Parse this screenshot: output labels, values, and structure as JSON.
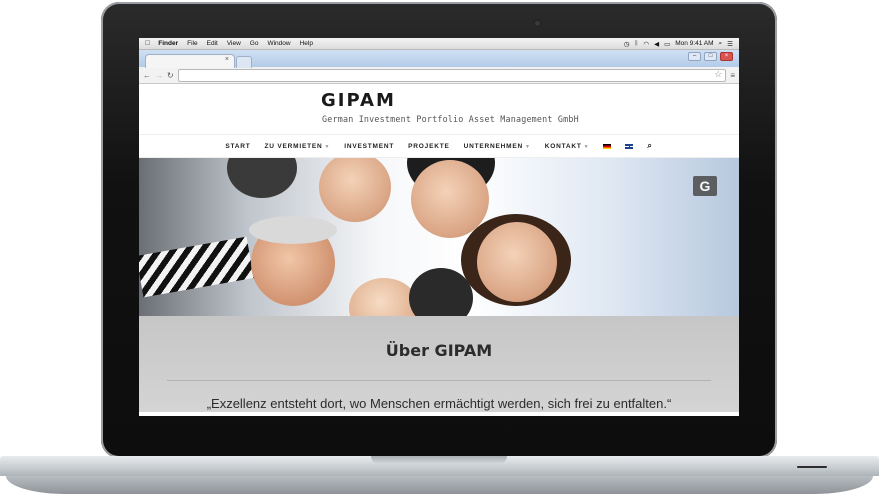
{
  "menubar": {
    "apple": "",
    "items": [
      "Finder",
      "File",
      "Edit",
      "View",
      "Go",
      "Window",
      "Help"
    ],
    "clock": "Mon 9:41 AM"
  },
  "browser": {
    "tab_close": "×",
    "address": "",
    "window_controls": [
      "–",
      "□",
      "×"
    ]
  },
  "site": {
    "logo": "GIPAM",
    "tagline": "German Investment Portfolio Asset Management GmbH",
    "nav": [
      {
        "label": "START"
      },
      {
        "label": "ZU VERMIETEN",
        "dropdown": true
      },
      {
        "label": "INVESTMENT"
      },
      {
        "label": "PROJEKTE"
      },
      {
        "label": "UNTERNEHMEN",
        "dropdown": true
      },
      {
        "label": "KONTAKT",
        "dropdown": true
      }
    ],
    "hero_badge": "G",
    "about_title": "Über GIPAM",
    "about_quote": "„Exzellenz entsteht dort, wo Menschen ermächtigt werden, sich frei zu entfalten.“"
  },
  "colors": {
    "about_bg": "#c9c9c9",
    "laptop_frame": "#111111"
  }
}
